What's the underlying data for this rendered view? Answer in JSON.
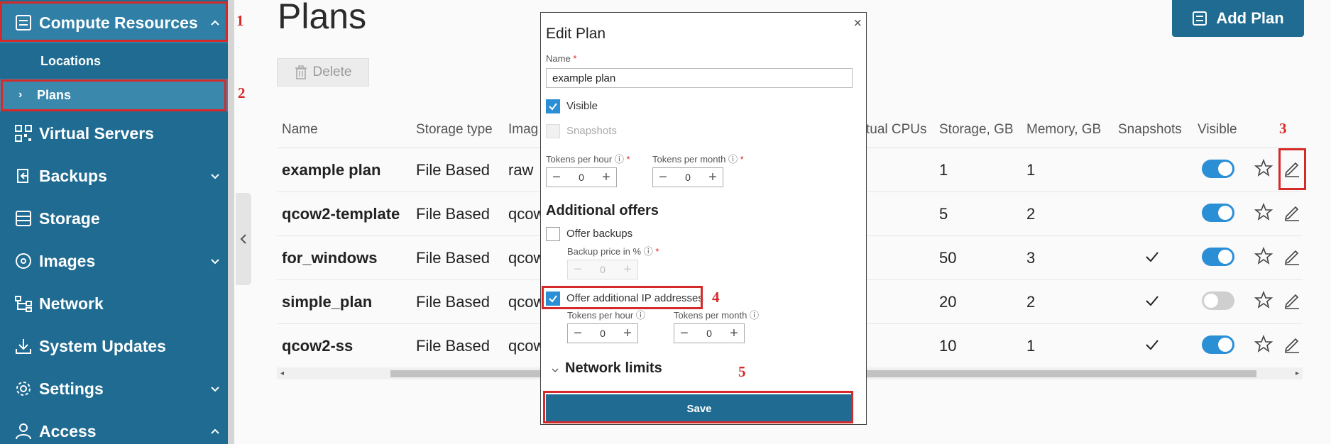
{
  "sidebar": {
    "items": [
      {
        "label": "Compute Resources",
        "icon": "server-icon",
        "expanded": true
      },
      {
        "label": "Virtual Servers",
        "icon": "qr-icon"
      },
      {
        "label": "Backups",
        "icon": "backup-icon"
      },
      {
        "label": "Storage",
        "icon": "storage-icon"
      },
      {
        "label": "Images",
        "icon": "disc-icon"
      },
      {
        "label": "Network",
        "icon": "network-icon"
      },
      {
        "label": "System Updates",
        "icon": "download-icon"
      },
      {
        "label": "Settings",
        "icon": "gear-icon"
      },
      {
        "label": "Access",
        "icon": "user-icon"
      }
    ],
    "sub_items": [
      {
        "label": "Locations"
      },
      {
        "label": "Plans",
        "prefix": "›"
      }
    ]
  },
  "markers": [
    "1",
    "2",
    "3",
    "4",
    "5"
  ],
  "page": {
    "title": "Plans",
    "delete_label": "Delete",
    "add_plan_label": "Add Plan"
  },
  "table": {
    "headers": [
      "Name",
      "Storage type",
      "Imag",
      "tual CPUs",
      "Storage, GB",
      "Memory, GB",
      "Snapshots",
      "Visible"
    ],
    "rows": [
      {
        "name": "example plan",
        "storage_type": "File Based",
        "image": "raw",
        "storage": "1",
        "memory": "1",
        "snapshots": false,
        "visible": true
      },
      {
        "name": "qcow2-template",
        "storage_type": "File Based",
        "image": "qcow",
        "storage": "5",
        "memory": "2",
        "snapshots": false,
        "visible": true
      },
      {
        "name": "for_windows",
        "storage_type": "File Based",
        "image": "qcow",
        "storage": "50",
        "memory": "3",
        "snapshots": true,
        "visible": true
      },
      {
        "name": "simple_plan",
        "storage_type": "File Based",
        "image": "qcow",
        "storage": "20",
        "memory": "2",
        "snapshots": true,
        "visible": false
      },
      {
        "name": "qcow2-ss",
        "storage_type": "File Based",
        "image": "qcow",
        "storage": "10",
        "memory": "1",
        "snapshots": true,
        "visible": true
      }
    ]
  },
  "modal": {
    "title": "Edit Plan",
    "name_label": "Name",
    "required_mark": "*",
    "name_value": "example plan",
    "visible_label": "Visible",
    "visible_checked": true,
    "snapshots_label": "Snapshots",
    "tokens_hour_label": "Tokens per hour",
    "tokens_month_label": "Tokens per month",
    "tokens_hour_value": "0",
    "tokens_month_value": "0",
    "additional_offers_title": "Additional offers",
    "offer_backups_label": "Offer backups",
    "offer_backups_checked": false,
    "backup_price_label": "Backup price in %",
    "backup_price_value": "0",
    "offer_ip_label": "Offer additional IP addresses",
    "offer_ip_checked": true,
    "ip_tokens_hour_label": "Tokens per hour",
    "ip_tokens_month_label": "Tokens per month",
    "ip_tokens_hour_value": "0",
    "ip_tokens_month_value": "0",
    "network_limits_label": "Network limits",
    "save_label": "Save",
    "close_symbol": "×"
  },
  "colors": {
    "sidebar": "#1f6b91",
    "toggle_on": "#2b8fd6",
    "highlight": "#d62a2a"
  }
}
